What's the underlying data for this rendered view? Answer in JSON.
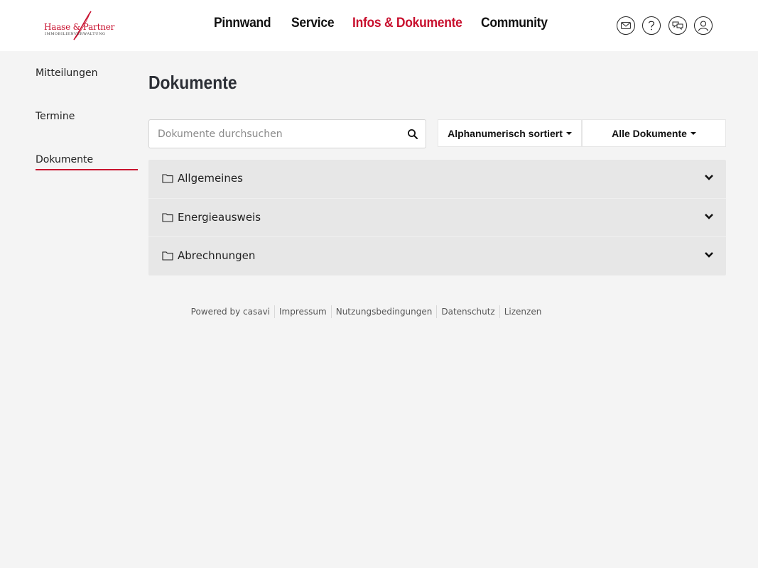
{
  "logo": {
    "name": "Haase & Partner",
    "tagline": "IMMOBILIENVERWALTUNG"
  },
  "nav": {
    "items": [
      {
        "label": "Pinnwand",
        "active": false
      },
      {
        "label": "Service",
        "active": false
      },
      {
        "label": "Infos & Dokumente",
        "active": true
      },
      {
        "label": "Community",
        "active": false
      }
    ]
  },
  "header_icons": [
    "mail-icon",
    "help-icon",
    "chat-icon",
    "user-icon"
  ],
  "sidebar": {
    "items": [
      {
        "label": "Mitteilungen",
        "active": false
      },
      {
        "label": "Termine",
        "active": false
      },
      {
        "label": "Dokumente",
        "active": true
      }
    ]
  },
  "main": {
    "title": "Dokumente",
    "search": {
      "placeholder": "Dokumente durchsuchen",
      "value": ""
    },
    "sort_dropdown": {
      "label": "Alphanumerisch sortiert"
    },
    "filter_dropdown": {
      "label": "Alle Dokumente"
    },
    "folders": [
      {
        "label": "Allgemeines"
      },
      {
        "label": "Energieausweis"
      },
      {
        "label": "Abrechnungen"
      }
    ]
  },
  "footer": {
    "links": [
      "Powered by casavi",
      "Impressum",
      "Nutzungsbedingungen",
      "Datenschutz",
      "Lizenzen"
    ]
  },
  "colors": {
    "accent": "#c8102e",
    "background": "#f4f4f4",
    "header": "#ffffff",
    "folder_row": "#e7e7e7"
  }
}
